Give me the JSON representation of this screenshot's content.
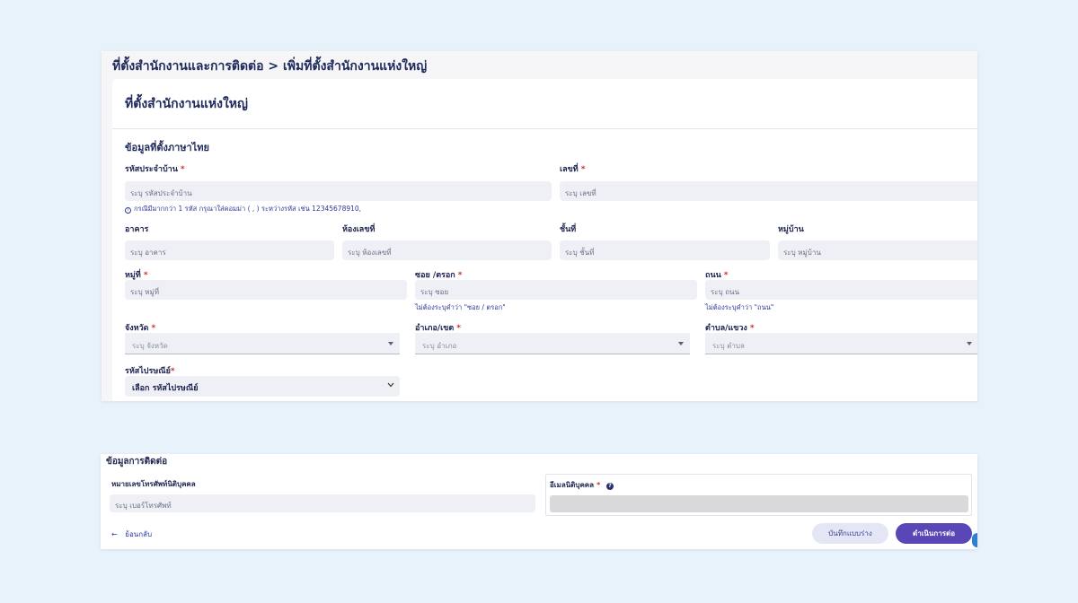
{
  "breadcrumb": "ที่ตั้งสำนักงานและการติดต่อ > เพิ่มที่ตั้งสำนักงานแห่งใหญ่",
  "page_title": "ที่ตั้งสำนักงานแห่งใหญ่",
  "section_thai": "ข้อมูลที่ตั้งภาษาไทย",
  "required_mark": "*",
  "fields": {
    "house_code": {
      "label": "รหัสประจำบ้าน",
      "placeholder": "ระบุ รหัสประจำบ้าน"
    },
    "house_no": {
      "label": "เลขที่",
      "placeholder": "ระบุ เลขที่"
    },
    "house_code_hint": "กรณีมีมากกว่า 1 รหัส กรุณาใส่คอมม่า ( , ) ระหว่างรหัส เช่น 12345678910,",
    "building": {
      "label": "อาคาร",
      "placeholder": "ระบุ อาคาร"
    },
    "room_no": {
      "label": "ห้องเลขที่",
      "placeholder": "ระบุ ห้องเลขที่"
    },
    "floor": {
      "label": "ชั้นที่",
      "placeholder": "ระบุ ชั้นที่"
    },
    "village": {
      "label": "หมู่บ้าน",
      "placeholder": "ระบุ หมู่บ้าน"
    },
    "moo": {
      "label": "หมู่ที่",
      "placeholder": "ระบุ หมู่ที่"
    },
    "soi": {
      "label": "ซอย /ตรอก",
      "placeholder": "ระบุ ซอย",
      "hint": "ไม่ต้องระบุคำว่า \"ซอย / ตรอก\""
    },
    "road": {
      "label": "ถนน",
      "placeholder": "ระบุ ถนน",
      "hint": "ไม่ต้องระบุคำว่า \"ถนน\""
    },
    "province": {
      "label": "จังหวัด",
      "placeholder": "ระบุ จังหวัด"
    },
    "district": {
      "label": "อำเภอ/เขต",
      "placeholder": "ระบุ อำเภอ"
    },
    "subdistrict": {
      "label": "ตำบล/แขวง",
      "placeholder": "ระบุ ตำบล"
    },
    "postal": {
      "label": "รหัสไปรษณีย์",
      "selected": "เลือก รหัสไปรษณีย์"
    }
  },
  "contact": {
    "title": "ข้อมูลการติดต่อ",
    "phone": {
      "label": "หมายเลขโทรศัพท์นิติบุคคล",
      "placeholder": "ระบุ เบอร์โทรศัพท์"
    },
    "email": {
      "label": "อีเมลนิติบุคคล",
      "help": "?"
    }
  },
  "actions": {
    "back": "ย้อนกลับ",
    "back_icon": "←",
    "save_draft": "บันทึกแบบร่าง",
    "next": "ดำเนินการต่อ"
  }
}
